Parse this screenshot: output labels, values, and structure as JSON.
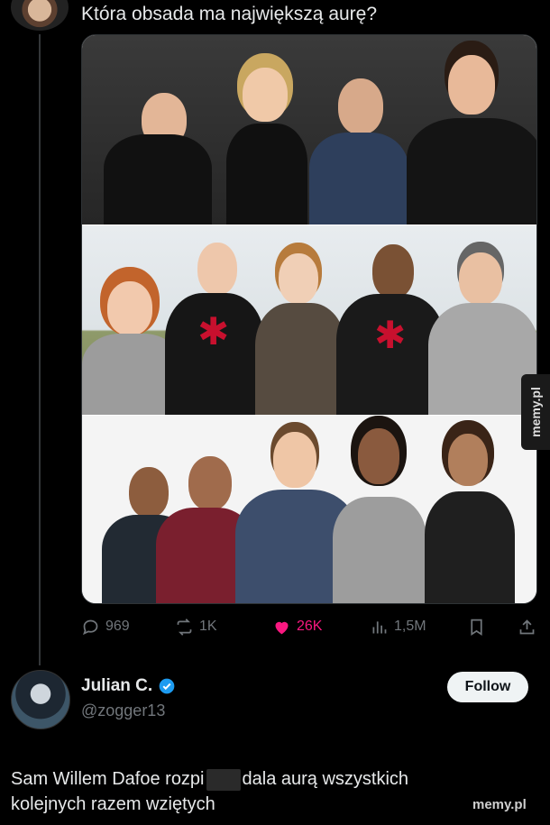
{
  "tweet": {
    "text": "Która obsada ma największą aurę?"
  },
  "media": {
    "panels": [
      "cast-2002",
      "cast-2012",
      "cast-2017"
    ]
  },
  "actions": {
    "replies": "969",
    "reposts": "1K",
    "likes": "26K",
    "views": "1,5M"
  },
  "watermark": {
    "side": "memy.pl",
    "bottom": "memy.pl"
  },
  "reply": {
    "name": "Julian C.",
    "handle": "@zogger13",
    "follow_label": "Follow",
    "text_part1": "Sam Willem Dafoe rozpi",
    "text_part2": "dala aurą wszystkich kolejnych razem wziętych"
  },
  "colors": {
    "like": "#f91880",
    "verified": "#1d9bf0",
    "muted": "#71767b"
  }
}
